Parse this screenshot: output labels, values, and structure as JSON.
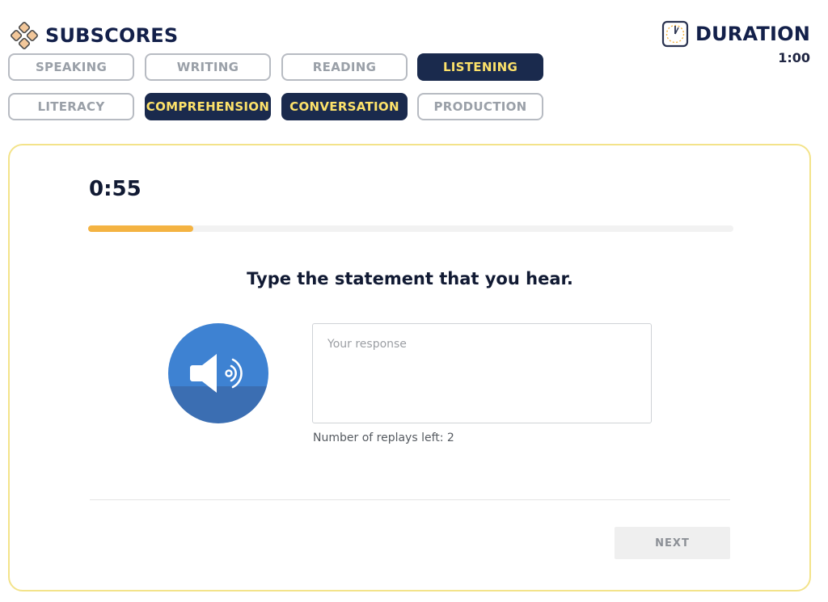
{
  "header": {
    "title": "SUBSCORES",
    "logo_icon": "subscores-logo-icon"
  },
  "duration": {
    "title": "DURATION",
    "value": "1:00",
    "icon": "clock-icon"
  },
  "subscores": {
    "row1": [
      {
        "label": "SPEAKING",
        "active": false
      },
      {
        "label": "WRITING",
        "active": false
      },
      {
        "label": "READING",
        "active": false
      },
      {
        "label": "LISTENING",
        "active": true
      }
    ],
    "row2": [
      {
        "label": "LITERACY",
        "active": false
      },
      {
        "label": "COMPREHENSION",
        "active": true
      },
      {
        "label": "CONVERSATION",
        "active": true
      },
      {
        "label": "PRODUCTION",
        "active": false
      }
    ]
  },
  "question": {
    "timer": "0:55",
    "progress_fraction": 0.163,
    "prompt": "Type the statement that you hear.",
    "response_placeholder": "Your response",
    "response_value": "",
    "replays_text": "Number of replays left: 2",
    "speaker_icon": "speaker-icon",
    "next_label": "NEXT"
  },
  "colors": {
    "navy": "#1a2a4d",
    "active_text": "#fde26a",
    "progress": "#f4b342",
    "card_border": "#f3e38a",
    "speaker_blue": "#3e82d2"
  }
}
